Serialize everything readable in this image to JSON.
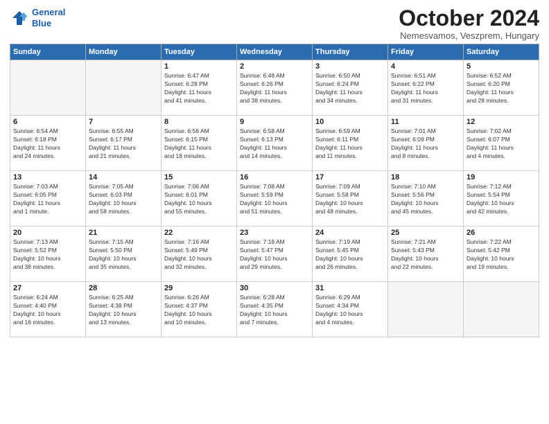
{
  "header": {
    "logo_line1": "General",
    "logo_line2": "Blue",
    "month": "October 2024",
    "location": "Nemesvamos, Veszprem, Hungary"
  },
  "weekdays": [
    "Sunday",
    "Monday",
    "Tuesday",
    "Wednesday",
    "Thursday",
    "Friday",
    "Saturday"
  ],
  "weeks": [
    [
      {
        "day": "",
        "detail": ""
      },
      {
        "day": "",
        "detail": ""
      },
      {
        "day": "1",
        "detail": "Sunrise: 6:47 AM\nSunset: 6:28 PM\nDaylight: 11 hours\nand 41 minutes."
      },
      {
        "day": "2",
        "detail": "Sunrise: 6:48 AM\nSunset: 6:26 PM\nDaylight: 11 hours\nand 38 minutes."
      },
      {
        "day": "3",
        "detail": "Sunrise: 6:50 AM\nSunset: 6:24 PM\nDaylight: 11 hours\nand 34 minutes."
      },
      {
        "day": "4",
        "detail": "Sunrise: 6:51 AM\nSunset: 6:22 PM\nDaylight: 11 hours\nand 31 minutes."
      },
      {
        "day": "5",
        "detail": "Sunrise: 6:52 AM\nSunset: 6:20 PM\nDaylight: 11 hours\nand 28 minutes."
      }
    ],
    [
      {
        "day": "6",
        "detail": "Sunrise: 6:54 AM\nSunset: 6:18 PM\nDaylight: 11 hours\nand 24 minutes."
      },
      {
        "day": "7",
        "detail": "Sunrise: 6:55 AM\nSunset: 6:17 PM\nDaylight: 11 hours\nand 21 minutes."
      },
      {
        "day": "8",
        "detail": "Sunrise: 6:56 AM\nSunset: 6:15 PM\nDaylight: 11 hours\nand 18 minutes."
      },
      {
        "day": "9",
        "detail": "Sunrise: 6:58 AM\nSunset: 6:13 PM\nDaylight: 11 hours\nand 14 minutes."
      },
      {
        "day": "10",
        "detail": "Sunrise: 6:59 AM\nSunset: 6:11 PM\nDaylight: 11 hours\nand 11 minutes."
      },
      {
        "day": "11",
        "detail": "Sunrise: 7:01 AM\nSunset: 6:09 PM\nDaylight: 11 hours\nand 8 minutes."
      },
      {
        "day": "12",
        "detail": "Sunrise: 7:02 AM\nSunset: 6:07 PM\nDaylight: 11 hours\nand 4 minutes."
      }
    ],
    [
      {
        "day": "13",
        "detail": "Sunrise: 7:03 AM\nSunset: 6:05 PM\nDaylight: 11 hours\nand 1 minute."
      },
      {
        "day": "14",
        "detail": "Sunrise: 7:05 AM\nSunset: 6:03 PM\nDaylight: 10 hours\nand 58 minutes."
      },
      {
        "day": "15",
        "detail": "Sunrise: 7:06 AM\nSunset: 6:01 PM\nDaylight: 10 hours\nand 55 minutes."
      },
      {
        "day": "16",
        "detail": "Sunrise: 7:08 AM\nSunset: 5:59 PM\nDaylight: 10 hours\nand 51 minutes."
      },
      {
        "day": "17",
        "detail": "Sunrise: 7:09 AM\nSunset: 5:58 PM\nDaylight: 10 hours\nand 48 minutes."
      },
      {
        "day": "18",
        "detail": "Sunrise: 7:10 AM\nSunset: 5:56 PM\nDaylight: 10 hours\nand 45 minutes."
      },
      {
        "day": "19",
        "detail": "Sunrise: 7:12 AM\nSunset: 5:54 PM\nDaylight: 10 hours\nand 42 minutes."
      }
    ],
    [
      {
        "day": "20",
        "detail": "Sunrise: 7:13 AM\nSunset: 5:52 PM\nDaylight: 10 hours\nand 38 minutes."
      },
      {
        "day": "21",
        "detail": "Sunrise: 7:15 AM\nSunset: 5:50 PM\nDaylight: 10 hours\nand 35 minutes."
      },
      {
        "day": "22",
        "detail": "Sunrise: 7:16 AM\nSunset: 5:49 PM\nDaylight: 10 hours\nand 32 minutes."
      },
      {
        "day": "23",
        "detail": "Sunrise: 7:18 AM\nSunset: 5:47 PM\nDaylight: 10 hours\nand 29 minutes."
      },
      {
        "day": "24",
        "detail": "Sunrise: 7:19 AM\nSunset: 5:45 PM\nDaylight: 10 hours\nand 26 minutes."
      },
      {
        "day": "25",
        "detail": "Sunrise: 7:21 AM\nSunset: 5:43 PM\nDaylight: 10 hours\nand 22 minutes."
      },
      {
        "day": "26",
        "detail": "Sunrise: 7:22 AM\nSunset: 5:42 PM\nDaylight: 10 hours\nand 19 minutes."
      }
    ],
    [
      {
        "day": "27",
        "detail": "Sunrise: 6:24 AM\nSunset: 4:40 PM\nDaylight: 10 hours\nand 16 minutes."
      },
      {
        "day": "28",
        "detail": "Sunrise: 6:25 AM\nSunset: 4:38 PM\nDaylight: 10 hours\nand 13 minutes."
      },
      {
        "day": "29",
        "detail": "Sunrise: 6:26 AM\nSunset: 4:37 PM\nDaylight: 10 hours\nand 10 minutes."
      },
      {
        "day": "30",
        "detail": "Sunrise: 6:28 AM\nSunset: 4:35 PM\nDaylight: 10 hours\nand 7 minutes."
      },
      {
        "day": "31",
        "detail": "Sunrise: 6:29 AM\nSunset: 4:34 PM\nDaylight: 10 hours\nand 4 minutes."
      },
      {
        "day": "",
        "detail": ""
      },
      {
        "day": "",
        "detail": ""
      }
    ]
  ]
}
